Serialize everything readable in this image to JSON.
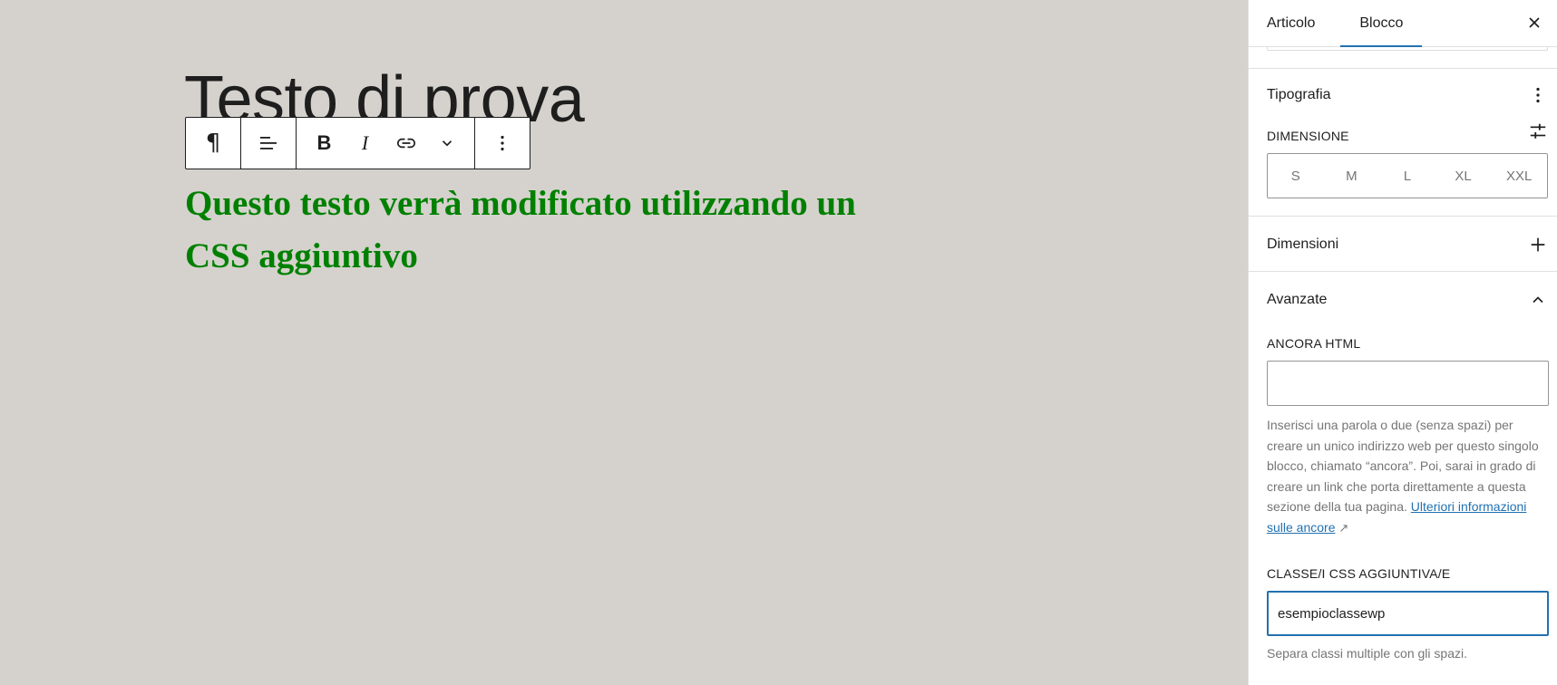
{
  "editor": {
    "title": "Testo di prova",
    "paragraph": "Questo testo verrà modificato utilizzando un CSS aggiuntivo"
  },
  "toolbar": {
    "buttons": [
      {
        "name": "paragraph-icon",
        "label": "¶"
      },
      {
        "name": "align-left-icon"
      },
      {
        "name": "bold-icon",
        "label": "B"
      },
      {
        "name": "italic-icon",
        "label": "I"
      },
      {
        "name": "link-icon"
      },
      {
        "name": "chevron-down-icon"
      },
      {
        "name": "more-vertical-icon"
      }
    ]
  },
  "sidebar": {
    "tabs": [
      "Articolo",
      "Blocco"
    ],
    "active_tab": "Blocco",
    "close_icon": "close-icon",
    "typography": {
      "title": "Tipografia",
      "size_label": "DIMENSIONE",
      "sizes": [
        "S",
        "M",
        "L",
        "XL",
        "XXL"
      ]
    },
    "dimensions": {
      "title": "Dimensioni"
    },
    "advanced": {
      "title": "Avanzate",
      "anchor_label": "ANCORA HTML",
      "anchor_value": "",
      "anchor_help": "Inserisci una parola o due (senza spazi) per creare un unico indirizzo web per questo singolo blocco, chiamato “ancora”. Poi, sarai in grado di creare un link che porta direttamente a questa sezione della tua pagina.",
      "anchor_link": "Ulteriori informazioni sulle ancore",
      "anchor_link_arrow": "↗",
      "css_label": "CLASSE/I CSS AGGIUNTIVA/E",
      "css_value": "esempioclassewp",
      "css_help": "Separa classi multiple con gli spazi."
    }
  },
  "colors": {
    "canvas_bg": "#d5d2cd",
    "paragraph_text": "#008000",
    "accent": "#2271b1"
  }
}
